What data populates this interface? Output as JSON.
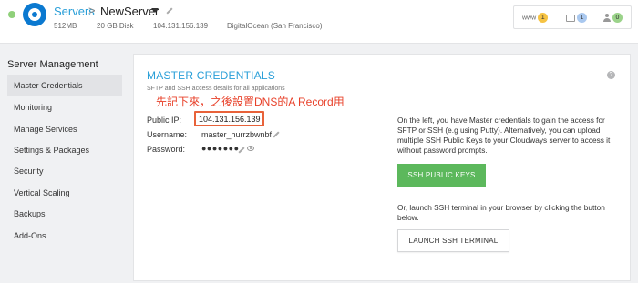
{
  "header": {
    "breadcrumb_root": "Servers",
    "breadcrumb_sep": ">",
    "server_name": "NewServer",
    "ram": "512MB",
    "disk": "20 GB Disk",
    "ip": "104.131.156.139",
    "provider_region": "DigitalOcean (San Francisco)",
    "status_color": "#8fd07a",
    "top_items": [
      {
        "label": "www",
        "count": "1",
        "badge_color": "#f6c343",
        "icon": "www-text"
      },
      {
        "label": "",
        "count": "1",
        "badge_color": "#a9c8ef",
        "icon": "folder-icon"
      },
      {
        "label": "",
        "count": "0",
        "badge_color": "#9bd38a",
        "icon": "user-icon"
      }
    ]
  },
  "sidebar": {
    "heading": "Server Management",
    "items": [
      {
        "label": "Master Credentials",
        "active": true
      },
      {
        "label": "Monitoring"
      },
      {
        "label": "Manage Services"
      },
      {
        "label": "Settings & Packages"
      },
      {
        "label": "Security"
      },
      {
        "label": "Vertical Scaling"
      },
      {
        "label": "Backups"
      },
      {
        "label": "Add-Ons"
      }
    ]
  },
  "panel": {
    "title": "MASTER CREDENTIALS",
    "subtitle": "SFTP and SSH access details for all applications",
    "help": "?",
    "annotation": "先記下來，之後設置DNS的A Record用",
    "annotation_color": "#e8412a",
    "fields": {
      "ip_label": "Public IP:",
      "ip_value": "104.131.156.139",
      "username_label": "Username:",
      "username_value": "master_hurrzbwnbf",
      "password_label": "Password:",
      "password_value": "●●●●●●●"
    },
    "right": {
      "text1": "On the left, you have Master credentials to gain the access for SFTP or SSH (e.g using Putty). Alternatively, you can upload multiple SSH Public Keys to your Cloudways server to access it without password prompts.",
      "ssh_keys_button": "SSH PUBLIC KEYS",
      "text2": "Or, launch SSH terminal in your browser by clicking the button below.",
      "launch_button": "LAUNCH SSH TERMINAL"
    },
    "accent_color": "#2a9fd8",
    "button_color": "#5cb85c"
  }
}
